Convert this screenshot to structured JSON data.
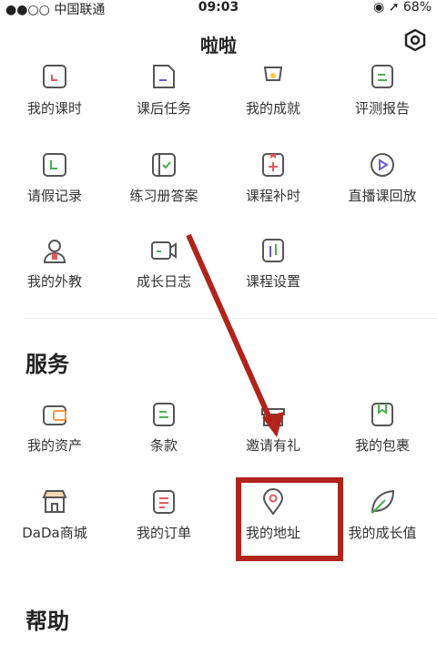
{
  "status_bar": {
    "carrier": "●●○○ 中国联通",
    "wifi_icon": "wifi-icon",
    "time": "09:03",
    "right": "◉ ➚ 68%"
  },
  "navbar": {
    "title": "啦啦",
    "settings_icon": "settings-hexagon-icon"
  },
  "courses": {
    "row1": [
      {
        "label": "我的课时",
        "icon": "course-hours-icon"
      },
      {
        "label": "课后任务",
        "icon": "homework-icon"
      },
      {
        "label": "我的成就",
        "icon": "achievement-icon"
      },
      {
        "label": "评测报告",
        "icon": "report-icon"
      }
    ],
    "row2": [
      {
        "label": "请假记录",
        "icon": "leave-record-icon"
      },
      {
        "label": "练习册答案",
        "icon": "workbook-answer-icon"
      },
      {
        "label": "课程补时",
        "icon": "makeup-time-icon"
      },
      {
        "label": "直播课回放",
        "icon": "live-replay-icon"
      }
    ],
    "row3": [
      {
        "label": "我的外教",
        "icon": "foreign-teacher-icon"
      },
      {
        "label": "成长日志",
        "icon": "growth-log-icon"
      },
      {
        "label": "课程设置",
        "icon": "course-settings-icon"
      }
    ]
  },
  "services": {
    "title": "服务",
    "row1": [
      {
        "label": "我的资产",
        "icon": "wallet-icon"
      },
      {
        "label": "条款",
        "icon": "terms-icon"
      },
      {
        "label": "邀请有礼",
        "icon": "gift-icon"
      },
      {
        "label": "我的包裹",
        "icon": "package-icon"
      }
    ],
    "row2": [
      {
        "label": "DaDa商城",
        "icon": "shop-icon"
      },
      {
        "label": "我的订单",
        "icon": "orders-icon"
      },
      {
        "label": "我的地址",
        "icon": "location-pin-icon"
      },
      {
        "label": "我的成长值",
        "icon": "leaf-icon"
      }
    ]
  },
  "help": {
    "title": "帮助"
  },
  "colors": {
    "icon_green": "#4caf50",
    "icon_red": "#e05a5a",
    "icon_purple": "#6a5acd",
    "annotation": "#b0241c"
  }
}
